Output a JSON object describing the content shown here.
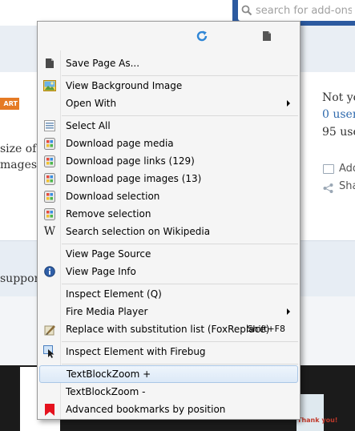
{
  "background_page": {
    "search_placeholder": "search for add-ons",
    "start_badge": "ART",
    "text_size_of": "size of",
    "text_images": "mages.",
    "text_support": "support",
    "text_not_yet": "Not yo",
    "text_users_link": "0 user",
    "text_users_count": "95 use",
    "side_add": "Add",
    "side_share": "Sha",
    "thumb_thanks": "Thank you!"
  },
  "toolbar": {
    "reload_icon": "reload-icon",
    "bookmark_icon": "bookmark-page-icon"
  },
  "menu": {
    "items": [
      {
        "label": "Save Page As...",
        "icon": "save-page-icon"
      },
      {
        "label": "View Background Image",
        "icon": "image-icon"
      },
      {
        "label": "Open With",
        "icon": "",
        "submenu": true
      },
      {
        "label": "Select All",
        "icon": "select-all-icon"
      },
      {
        "label": "Download page media",
        "icon": "download-media-icon"
      },
      {
        "label": "Download page links (129)",
        "icon": "download-links-icon"
      },
      {
        "label": "Download page images (13)",
        "icon": "download-images-icon"
      },
      {
        "label": "Download selection",
        "icon": "download-selection-icon"
      },
      {
        "label": "Remove selection",
        "icon": "remove-selection-icon"
      },
      {
        "label": "Search selection on Wikipedia",
        "icon": "wikipedia-icon"
      },
      {
        "label": "View Page Source",
        "icon": ""
      },
      {
        "label": "View Page Info",
        "icon": "info-icon"
      },
      {
        "label": "Inspect Element (Q)",
        "icon": ""
      },
      {
        "label": "Fire Media Player",
        "icon": "",
        "submenu": true
      },
      {
        "label": "Replace with substitution list (FoxReplace)",
        "icon": "foxreplace-icon",
        "shortcut": "Shift+F8"
      },
      {
        "label": "Inspect Element with Firebug",
        "icon": "firebug-inspect-icon"
      },
      {
        "label": "TextBlockZoom +",
        "icon": "",
        "highlighted": true
      },
      {
        "label": "TextBlockZoom -",
        "icon": ""
      },
      {
        "label": "Advanced bookmarks by position",
        "icon": "bookmark-flag-icon"
      }
    ]
  },
  "colors": {
    "menu_bg": "#f5f5f5",
    "highlight_border": "#a9c6e6",
    "link_blue": "#2f6aad",
    "header_blue": "#2c5aa0"
  }
}
